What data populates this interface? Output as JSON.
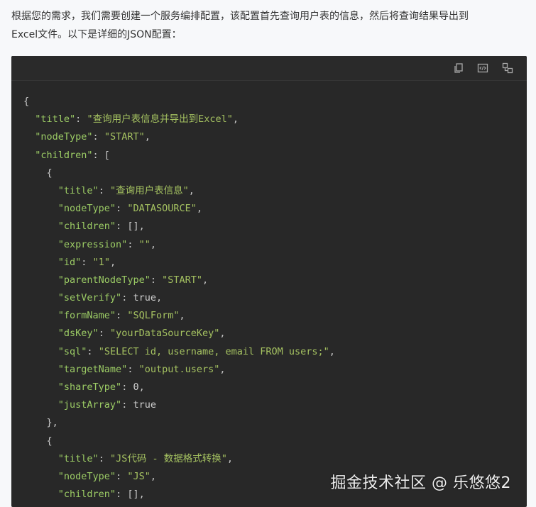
{
  "intro": {
    "line1": "根据您的需求，我们需要创建一个服务编排配置，该配置首先查询用户表的信息，然后将查询结果导出到",
    "line2": "Excel文件。以下是详细的JSON配置："
  },
  "toolbar": {
    "copy_icon": "copy-icon",
    "code_icon": "code-view-icon",
    "expand_icon": "layout-icon"
  },
  "code_lines": [
    {
      "indent": 0,
      "parts": [
        {
          "t": "{",
          "c": "p"
        }
      ]
    },
    {
      "indent": 1,
      "parts": [
        {
          "t": "\"title\"",
          "c": "k"
        },
        {
          "t": ": ",
          "c": "p"
        },
        {
          "t": "\"查询用户表信息并导出到Excel\"",
          "c": "s"
        },
        {
          "t": ",",
          "c": "p"
        }
      ]
    },
    {
      "indent": 1,
      "parts": [
        {
          "t": "\"nodeType\"",
          "c": "k"
        },
        {
          "t": ": ",
          "c": "p"
        },
        {
          "t": "\"START\"",
          "c": "s"
        },
        {
          "t": ",",
          "c": "p"
        }
      ]
    },
    {
      "indent": 1,
      "parts": [
        {
          "t": "\"children\"",
          "c": "k"
        },
        {
          "t": ": [",
          "c": "p"
        }
      ]
    },
    {
      "indent": 2,
      "parts": [
        {
          "t": "{",
          "c": "p"
        }
      ]
    },
    {
      "indent": 3,
      "parts": [
        {
          "t": "\"title\"",
          "c": "k"
        },
        {
          "t": ": ",
          "c": "p"
        },
        {
          "t": "\"查询用户表信息\"",
          "c": "s"
        },
        {
          "t": ",",
          "c": "p"
        }
      ]
    },
    {
      "indent": 3,
      "parts": [
        {
          "t": "\"nodeType\"",
          "c": "k"
        },
        {
          "t": ": ",
          "c": "p"
        },
        {
          "t": "\"DATASOURCE\"",
          "c": "s"
        },
        {
          "t": ",",
          "c": "p"
        }
      ]
    },
    {
      "indent": 3,
      "parts": [
        {
          "t": "\"children\"",
          "c": "k"
        },
        {
          "t": ": [],",
          "c": "p"
        }
      ]
    },
    {
      "indent": 3,
      "parts": [
        {
          "t": "\"expression\"",
          "c": "k"
        },
        {
          "t": ": ",
          "c": "p"
        },
        {
          "t": "\"\"",
          "c": "s"
        },
        {
          "t": ",",
          "c": "p"
        }
      ]
    },
    {
      "indent": 3,
      "parts": [
        {
          "t": "\"id\"",
          "c": "k"
        },
        {
          "t": ": ",
          "c": "p"
        },
        {
          "t": "\"1\"",
          "c": "s"
        },
        {
          "t": ",",
          "c": "p"
        }
      ]
    },
    {
      "indent": 3,
      "parts": [
        {
          "t": "\"parentNodeType\"",
          "c": "k"
        },
        {
          "t": ": ",
          "c": "p"
        },
        {
          "t": "\"START\"",
          "c": "s"
        },
        {
          "t": ",",
          "c": "p"
        }
      ]
    },
    {
      "indent": 3,
      "parts": [
        {
          "t": "\"setVerify\"",
          "c": "k"
        },
        {
          "t": ": ",
          "c": "p"
        },
        {
          "t": "true",
          "c": "b"
        },
        {
          "t": ",",
          "c": "p"
        }
      ]
    },
    {
      "indent": 3,
      "parts": [
        {
          "t": "\"formName\"",
          "c": "k"
        },
        {
          "t": ": ",
          "c": "p"
        },
        {
          "t": "\"SQLForm\"",
          "c": "s"
        },
        {
          "t": ",",
          "c": "p"
        }
      ]
    },
    {
      "indent": 3,
      "parts": [
        {
          "t": "\"dsKey\"",
          "c": "k"
        },
        {
          "t": ": ",
          "c": "p"
        },
        {
          "t": "\"yourDataSourceKey\"",
          "c": "s"
        },
        {
          "t": ",",
          "c": "p"
        }
      ]
    },
    {
      "indent": 3,
      "parts": [
        {
          "t": "\"sql\"",
          "c": "k"
        },
        {
          "t": ": ",
          "c": "p"
        },
        {
          "t": "\"SELECT id, username, email FROM users;\"",
          "c": "s"
        },
        {
          "t": ",",
          "c": "p"
        }
      ]
    },
    {
      "indent": 3,
      "parts": [
        {
          "t": "\"targetName\"",
          "c": "k"
        },
        {
          "t": ": ",
          "c": "p"
        },
        {
          "t": "\"output.users\"",
          "c": "s"
        },
        {
          "t": ",",
          "c": "p"
        }
      ]
    },
    {
      "indent": 3,
      "parts": [
        {
          "t": "\"shareType\"",
          "c": "k"
        },
        {
          "t": ": ",
          "c": "p"
        },
        {
          "t": "0",
          "c": "n"
        },
        {
          "t": ",",
          "c": "p"
        }
      ]
    },
    {
      "indent": 3,
      "parts": [
        {
          "t": "\"justArray\"",
          "c": "k"
        },
        {
          "t": ": ",
          "c": "p"
        },
        {
          "t": "true",
          "c": "b"
        }
      ]
    },
    {
      "indent": 2,
      "parts": [
        {
          "t": "},",
          "c": "p"
        }
      ]
    },
    {
      "indent": 2,
      "parts": [
        {
          "t": "{",
          "c": "p"
        }
      ]
    },
    {
      "indent": 3,
      "parts": [
        {
          "t": "\"title\"",
          "c": "k"
        },
        {
          "t": ": ",
          "c": "p"
        },
        {
          "t": "\"JS代码 - 数据格式转换\"",
          "c": "s"
        },
        {
          "t": ",",
          "c": "p"
        }
      ]
    },
    {
      "indent": 3,
      "parts": [
        {
          "t": "\"nodeType\"",
          "c": "k"
        },
        {
          "t": ": ",
          "c": "p"
        },
        {
          "t": "\"JS\"",
          "c": "s"
        },
        {
          "t": ",",
          "c": "p"
        }
      ]
    },
    {
      "indent": 3,
      "parts": [
        {
          "t": "\"children\"",
          "c": "k"
        },
        {
          "t": ": [],",
          "c": "p"
        }
      ]
    }
  ],
  "watermark": "掘金技术社区 @ 乐悠悠2"
}
